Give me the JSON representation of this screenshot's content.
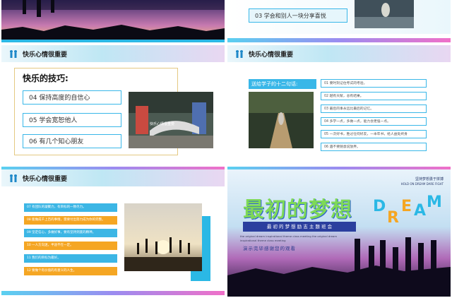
{
  "section_title": "快乐心情很重要",
  "slide2": {
    "item": "03   学会和别人一块分享喜悦"
  },
  "slide3": {
    "heading": "快乐的技巧:",
    "items": [
      "04   保持高度的自信心",
      "05   学会宽恕他人",
      "06   有几个知心朋友"
    ],
    "photo_caption": "快乐心情很重要"
  },
  "slide4": {
    "label": "送给学子的十二句话:",
    "rows": [
      "01   要时刻记住考试的考验。",
      "02   越有天赋，总有结果。",
      "03   最后的事永远比最后的记忆。",
      "04   多学一点，多做一点，能力会更强一点。",
      "05   一次好书，胜过任何好友，一本年书，给人益处终身",
      "06   遇不要随意说放弃。"
    ]
  },
  "slide5": {
    "rows": [
      "07   有团队的凝聚力，有目标的一致尽力。",
      "08   能做成千上百的事情，需要付出努力成为你的完整。",
      "09   坚定信心，多做好事，要有坚持到底的精神。",
      "10   一人方向迷，半途不在一定。",
      "11   我们的目标为最好。",
      "12   要做个有价值的有意义的人生。"
    ],
    "row_colors": [
      "#3cb6e5",
      "#f5a623",
      "#3cb6e5",
      "#f5a623",
      "#3cb6e5",
      "#f5a623"
    ]
  },
  "slide6": {
    "top_right_1": "坚持梦想勇于拼搏",
    "top_right_2": "HOLD ON DREAM DARE FIGHT",
    "title": "最初的梦想",
    "dream": [
      "D",
      "R",
      "E",
      "A",
      "M"
    ],
    "subtitle": "最 初 的 梦 想 励 志 主 题 班 会",
    "en_line1": "the original dream inspirational theme class meeting the original dream",
    "en_line2": "inspirational theme class meeting",
    "speaker_line": "演示完毕感谢您的观看"
  },
  "colors": {
    "accent_blue": "#39b7e8",
    "accent_orange": "#f5a623",
    "dark": "#1a1030",
    "title_green": "#7ed957"
  }
}
